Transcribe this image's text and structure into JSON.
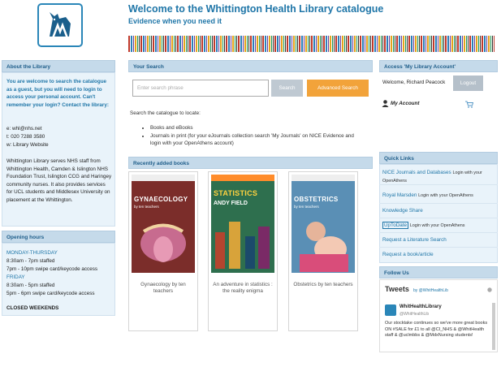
{
  "header": {
    "title": "Welcome to the Whittington Health Library catalogue",
    "subtitle": "Evidence when you need it",
    "logo_icon": "whittington-cat-logo"
  },
  "colors": {
    "brand_blue": "#1f76a8",
    "panel_header": "#c5daea",
    "panel_body": "#e9f3fa",
    "advanced_orange": "#f2a33a"
  },
  "about": {
    "heading": "About the Library",
    "intro": "You are welcome to search the catalogue as a guest, but you will need to login to access your personal account. Can't remember your login? Contact the library:",
    "email": "e: whl@nhs.net",
    "phone": "t:  020 7288 3580",
    "website": "w: Library Website",
    "description": "Whittington Library serves NHS staff from Whittington Health, Camden & Islington NHS Foundation Trust, Islington CCG and Haringey community nurses. It also provides services for UCL students and Middlesex University on placement at the Whittington."
  },
  "hours": {
    "heading": "Opening hours",
    "weekday_label": "MONDAY-THURSDAY",
    "weekday_staffed": "8:30am - 7pm staffed",
    "weekday_swipe": "7pm - 10pm swipe card/keycode access",
    "friday_label": "FRIDAY",
    "friday_staffed": "8:30am - 5pm staffed",
    "friday_swipe": "5pm - 6pm swipe card/keycode access",
    "weekends": "CLOSED WEEKENDS"
  },
  "search": {
    "heading": "Your Search",
    "placeholder": "Enter search phrase",
    "search_button": "Search",
    "advanced_button": "Advanced Search",
    "locate_text": "Search the catalogue to locate:",
    "bullets": [
      "Books and eBooks",
      "Journals in print (for your eJournals collection search  'My Journals'  on NICE Evidence and login with your OpenAthens account)"
    ]
  },
  "recent": {
    "heading": "Recently added books",
    "books": [
      {
        "cover_title": "GYNAECOLOGY",
        "cover_sub": "by ten teachers",
        "caption": "Gynaecology by ten teachers",
        "cover_color": "#7b2d2a"
      },
      {
        "cover_title": "STATISTICS",
        "cover_sub": "ANDY FIELD",
        "caption": "An adventure in statistics : the reality enigma",
        "cover_color": "#2e6f4e"
      },
      {
        "cover_title": "OBSTETRICS",
        "cover_sub": "by ten teachers",
        "caption": "Obstetrics by ten teachers",
        "cover_color": "#5a8fb5"
      }
    ]
  },
  "account": {
    "heading": "Access 'My Library Account'",
    "welcome": "Welcome, Richard Peacock",
    "logout_button": "Logout",
    "my_account": "My Account"
  },
  "quick_links": {
    "heading": "Quick Links",
    "items": [
      {
        "label": "NICE Journals and Databases",
        "note": "Login with your OpenAthens"
      },
      {
        "label": "Royal Marsden",
        "note": "Login with your OpenAthens"
      },
      {
        "label": "Knowledge Share",
        "note": ""
      },
      {
        "label": "UpToDate",
        "note": "Login with your OpenAthens"
      },
      {
        "label": "Request a Literature Search",
        "note": ""
      },
      {
        "label": "Request a book/article",
        "note": ""
      }
    ]
  },
  "follow": {
    "heading": "Follow Us",
    "tweets_title": "Tweets",
    "tweets_by": "by @WhitHealthLib",
    "tweet_name": "WhitHealthLibrary",
    "tweet_handle": "@WhitHealthLib",
    "tweet_text": "Our stocktake continues so we've more great books ON #SALE for £1 to all @CI_NHS & @WhitHealth staff & @uclmbbs & @MdxNursing students!"
  }
}
